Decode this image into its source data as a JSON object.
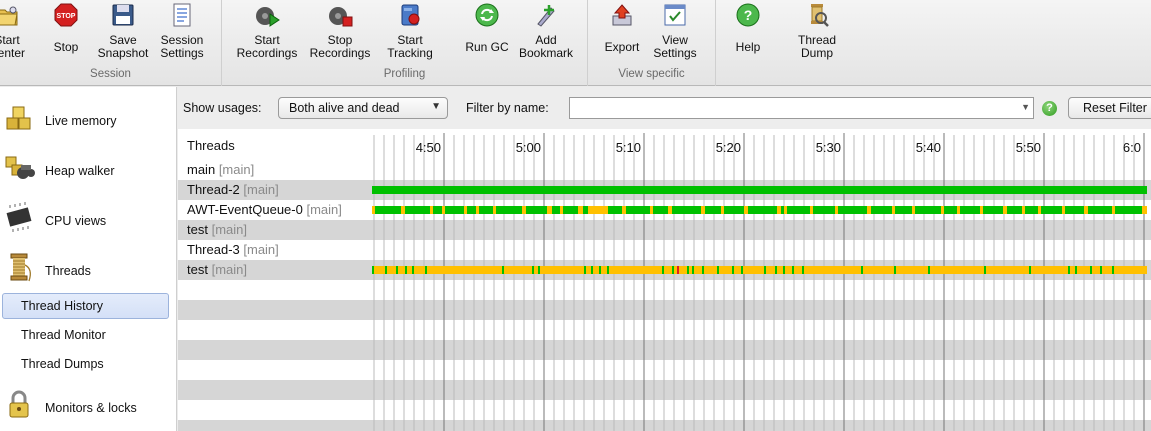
{
  "toolbar": {
    "groups": [
      {
        "caption": "Session",
        "buttons": [
          {
            "label": "Start\nCenter",
            "icon": "start-center-folder-icon",
            "name": "start-center-button"
          },
          {
            "label": "Stop",
            "icon": "stop-sign-icon",
            "name": "stop-button"
          },
          {
            "label": "Save\nSnapshot",
            "icon": "floppy-disk-icon",
            "name": "save-snapshot-button"
          },
          {
            "label": "Session\nSettings",
            "icon": "session-settings-icon",
            "name": "session-settings-button"
          }
        ]
      },
      {
        "caption": "Profiling",
        "buttons": [
          {
            "label": "Start\nRecordings",
            "icon": "start-recordings-icon",
            "name": "start-recordings-button"
          },
          {
            "label": "Stop\nRecordings",
            "icon": "stop-recordings-icon",
            "name": "stop-recordings-button"
          },
          {
            "label": "Start\nTracking",
            "icon": "start-tracking-icon",
            "name": "start-tracking-button"
          },
          {
            "label": "Run GC",
            "icon": "recycle-icon",
            "name": "run-gc-button"
          },
          {
            "label": "Add\nBookmark",
            "icon": "add-bookmark-icon",
            "name": "add-bookmark-button"
          }
        ]
      },
      {
        "caption": "View specific",
        "buttons": [
          {
            "label": "Export",
            "icon": "export-icon",
            "name": "export-button"
          },
          {
            "label": "View\nSettings",
            "icon": "view-settings-icon",
            "name": "view-settings-button"
          },
          {
            "label": "Help",
            "icon": "help-icon",
            "name": "help-button"
          }
        ]
      },
      {
        "caption": "",
        "buttons": [
          {
            "label": "Thread\nDump",
            "icon": "thread-dump-icon",
            "name": "thread-dump-button"
          }
        ]
      }
    ]
  },
  "sidebar": {
    "items": [
      {
        "label": "Live memory",
        "icon": "live-memory-icon"
      },
      {
        "label": "Heap walker",
        "icon": "heap-walker-icon"
      },
      {
        "label": "CPU views",
        "icon": "cpu-chip-icon"
      },
      {
        "label": "Threads",
        "icon": "thread-spool-icon"
      },
      {
        "label": "Monitors & locks",
        "icon": "padlock-icon"
      }
    ],
    "subitems": [
      {
        "label": "Thread History",
        "selected": true
      },
      {
        "label": "Thread Monitor",
        "selected": false
      },
      {
        "label": "Thread Dumps",
        "selected": false
      }
    ]
  },
  "filter": {
    "show_usages_label": "Show usages:",
    "show_usages_value": "Both alive and dead",
    "filter_by_name_label": "Filter by name:",
    "filter_value": "",
    "reset_label": "Reset Filter"
  },
  "timeline": {
    "header": "Threads",
    "time_labels": [
      "4:50",
      "5:00",
      "5:10",
      "5:20",
      "5:30",
      "5:40",
      "5:50",
      "6:0"
    ],
    "threads": [
      {
        "name": "main",
        "group": "[main]"
      },
      {
        "name": "Thread-2",
        "group": "[main]"
      },
      {
        "name": "AWT-EventQueue-0",
        "group": "[main]"
      },
      {
        "name": "test",
        "group": "[main]"
      },
      {
        "name": "Thread-3",
        "group": "[main]"
      },
      {
        "name": "test",
        "group": "[main]"
      }
    ],
    "state_colors": {
      "running": "#00c000",
      "waiting": "#ffc000",
      "blocked": "#e02020"
    }
  }
}
